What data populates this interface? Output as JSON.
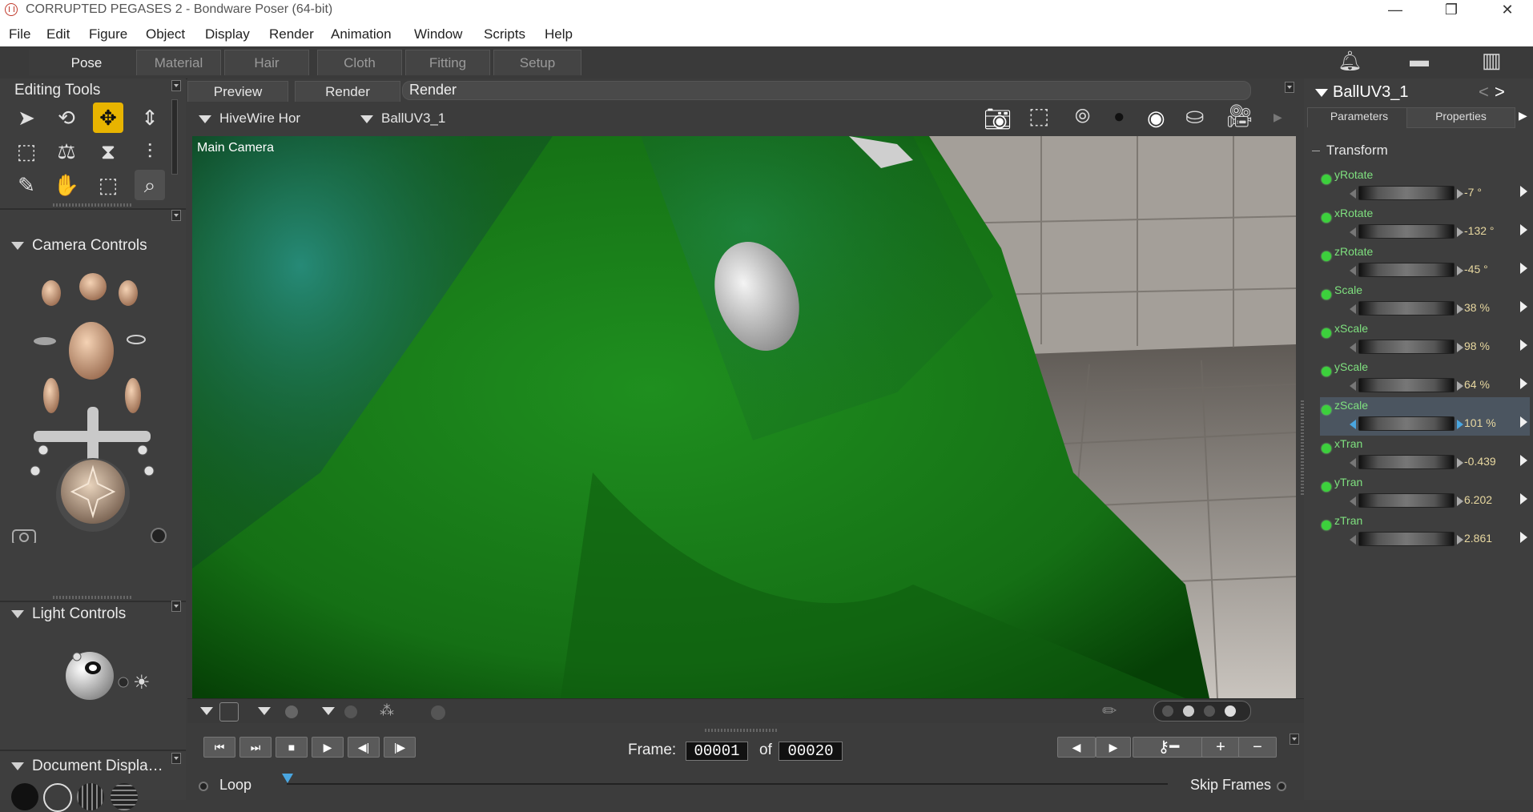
{
  "window": {
    "title": "CORRUPTED PEGASES 2 - Bondware Poser (64-bit)",
    "controls": [
      "—",
      "❐",
      "✕"
    ]
  },
  "menu": [
    "File",
    "Edit",
    "Figure",
    "Object",
    "Display",
    "Render",
    "Animation",
    "Window",
    "Scripts",
    "Help"
  ],
  "rooms": [
    "Pose",
    "Material",
    "Hair",
    "Cloth",
    "Fitting",
    "Setup"
  ],
  "editing_tools": {
    "title": "Editing Tools"
  },
  "camera_controls": {
    "title": "Camera Controls"
  },
  "light_controls": {
    "title": "Light Controls"
  },
  "document_display": {
    "title": "Document  Displa…"
  },
  "document": {
    "tabs": [
      "Preview",
      "Render"
    ],
    "render_label": "Render",
    "figure_select": "HiveWire Hor",
    "actor_select": "BallUV3_1",
    "camera_label": "Main Camera"
  },
  "transport": {
    "frame_label": "Frame:",
    "of_label": "of",
    "current_frame": "00001",
    "total_frames": "00020",
    "loop_label": "Loop",
    "skip_frames_label": "Skip Frames"
  },
  "parameters": {
    "actor": "BallUV3_1",
    "tabs": [
      "Parameters",
      "Properties"
    ],
    "group": "Transform",
    "items": [
      {
        "name": "yRotate",
        "value": "-7 °"
      },
      {
        "name": "xRotate",
        "value": "-132 °"
      },
      {
        "name": "zRotate",
        "value": "-45 °"
      },
      {
        "name": "Scale",
        "value": "38 %"
      },
      {
        "name": "xScale",
        "value": "98 %"
      },
      {
        "name": "yScale",
        "value": "64 %"
      },
      {
        "name": "zScale",
        "value": "101 %"
      },
      {
        "name": "xTran",
        "value": "-0.439"
      },
      {
        "name": "yTran",
        "value": "6.202"
      },
      {
        "name": "zTran",
        "value": "2.861"
      }
    ],
    "selected": "zScale"
  },
  "colors": {
    "active_tool": "#e8b400",
    "param_label": "#7fe07f",
    "param_dot": "#3cd03c",
    "horse_green": "#1c8a1c"
  }
}
